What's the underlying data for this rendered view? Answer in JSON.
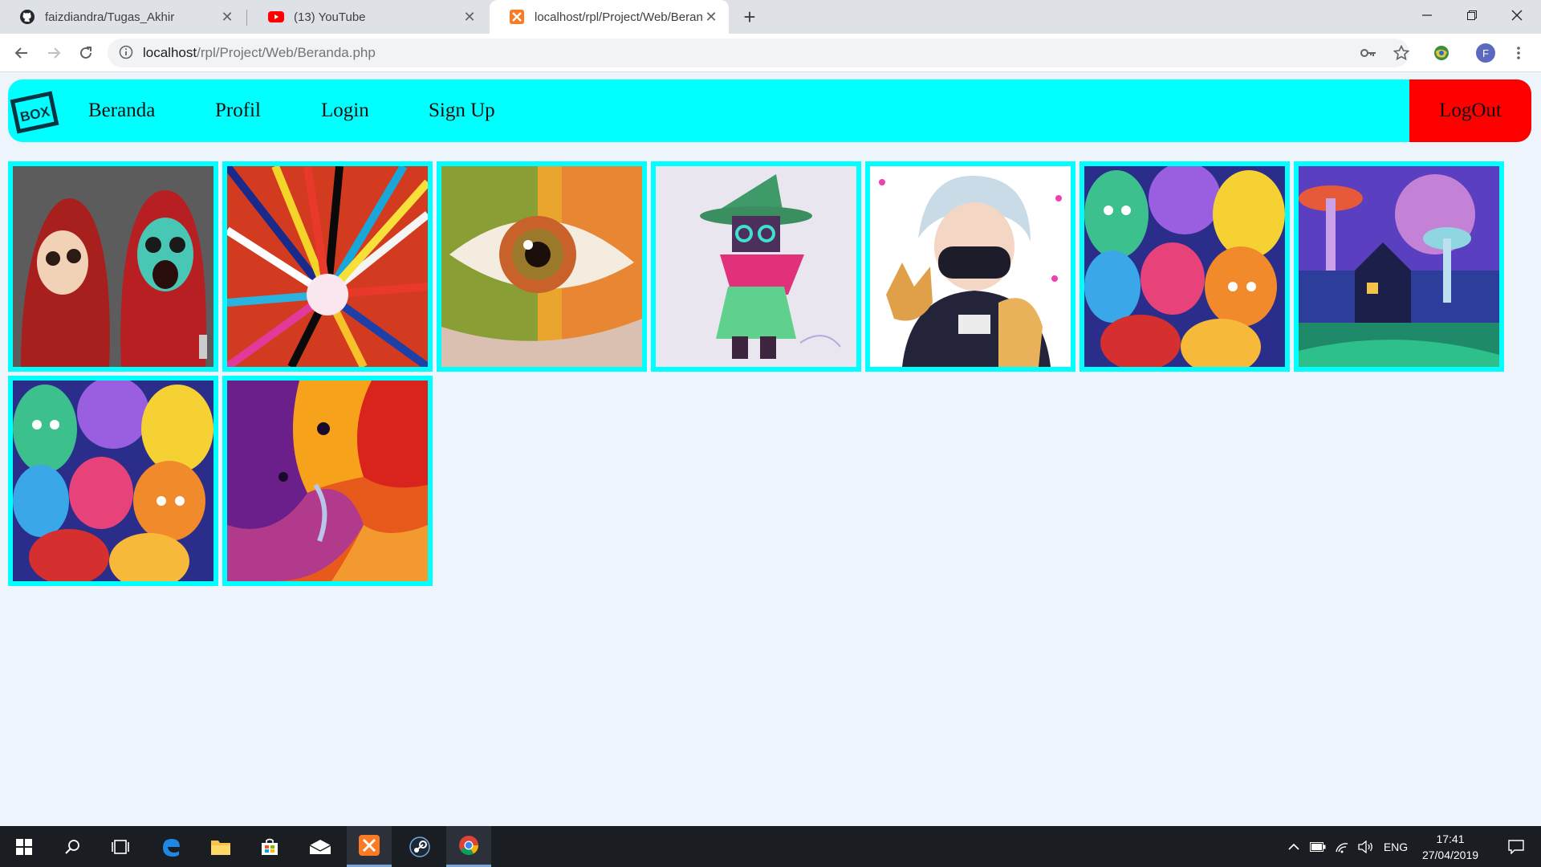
{
  "browser": {
    "tabs": [
      {
        "title": "faizdiandra/Tugas_Akhir",
        "icon": "github-icon",
        "active": false
      },
      {
        "title": "(13) YouTube",
        "icon": "youtube-icon",
        "active": false
      },
      {
        "title": "localhost/rpl/Project/Web/Beranda.php",
        "icon": "xampp-icon",
        "active": true
      }
    ],
    "address": {
      "host": "localhost",
      "path": "/rpl/Project/Web/Beranda.php"
    },
    "profile_initial": "F"
  },
  "site": {
    "logo_text": "BOX",
    "nav": [
      "Beranda",
      "Profil",
      "Login",
      "Sign Up"
    ],
    "logout_label": "LogOut",
    "colors": {
      "nav_bg": "#00ffff",
      "logout_bg": "#ff0000",
      "card_border": "#00ffff",
      "page_bg": "#eef4fb"
    }
  },
  "gallery": [
    {
      "name": "coco-skeleton-art"
    },
    {
      "name": "paint-explosion-art"
    },
    {
      "name": "colorful-eye-art"
    },
    {
      "name": "wizard-character-art"
    },
    {
      "name": "masked-boy-with-dog-art"
    },
    {
      "name": "colorful-cats-art"
    },
    {
      "name": "psychedelic-mushroom-forest-art"
    },
    {
      "name": "colorful-cats-art"
    },
    {
      "name": "fluid-paint-art"
    }
  ],
  "taskbar": {
    "apps": [
      "start-icon",
      "search-icon",
      "task-view-icon",
      "edge-icon",
      "file-explorer-icon",
      "store-icon",
      "mail-icon",
      "xampp-icon",
      "steam-icon",
      "chrome-icon"
    ],
    "language": "ENG",
    "time": "17:41",
    "date": "27/04/2019"
  }
}
